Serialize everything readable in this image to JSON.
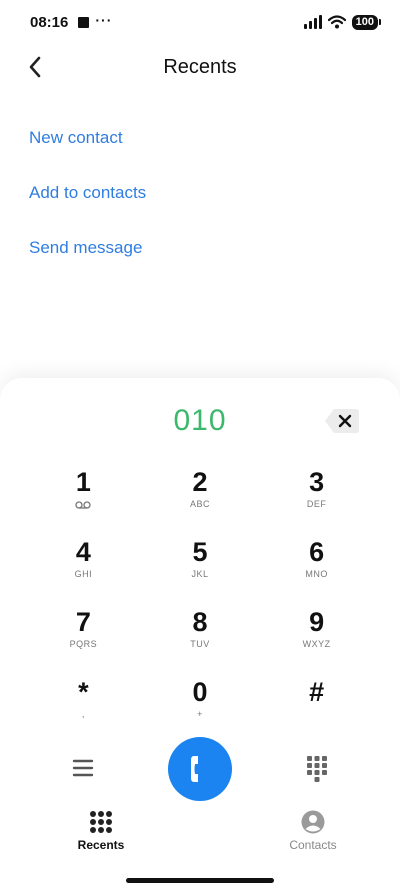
{
  "status_bar": {
    "time": "08:16",
    "dots": "···",
    "battery": "100"
  },
  "header": {
    "title": "Recents",
    "back_icon": "chevron-left-icon"
  },
  "actions": [
    {
      "label": "New contact"
    },
    {
      "label": "Add to contacts"
    },
    {
      "label": "Send message"
    }
  ],
  "dialer": {
    "number": "010",
    "backspace_icon": "backspace-icon",
    "keys": [
      {
        "digit": "1",
        "sub": "",
        "sub_icon": "voicemail-icon"
      },
      {
        "digit": "2",
        "sub": "ABC"
      },
      {
        "digit": "3",
        "sub": "DEF"
      },
      {
        "digit": "4",
        "sub": "GHI"
      },
      {
        "digit": "5",
        "sub": "JKL"
      },
      {
        "digit": "6",
        "sub": "MNO"
      },
      {
        "digit": "7",
        "sub": "PQRS"
      },
      {
        "digit": "8",
        "sub": "TUV"
      },
      {
        "digit": "9",
        "sub": "WXYZ"
      },
      {
        "digit": "*",
        "sub": ","
      },
      {
        "digit": "0",
        "sub": "+"
      },
      {
        "digit": "#",
        "sub": ""
      }
    ]
  },
  "controls": {
    "menu_icon": "menu-icon",
    "call_icon": "phone-icon",
    "keypad_icon": "dialpad-icon"
  },
  "bottom_nav": {
    "tabs": [
      {
        "label": "Recents",
        "icon": "dialpad-icon",
        "active": true
      },
      {
        "label": "Contacts",
        "icon": "person-circle-icon",
        "active": false
      }
    ]
  },
  "colors": {
    "link": "#2f7de1",
    "number": "#3bb86b",
    "call_button": "#1b84f0"
  }
}
